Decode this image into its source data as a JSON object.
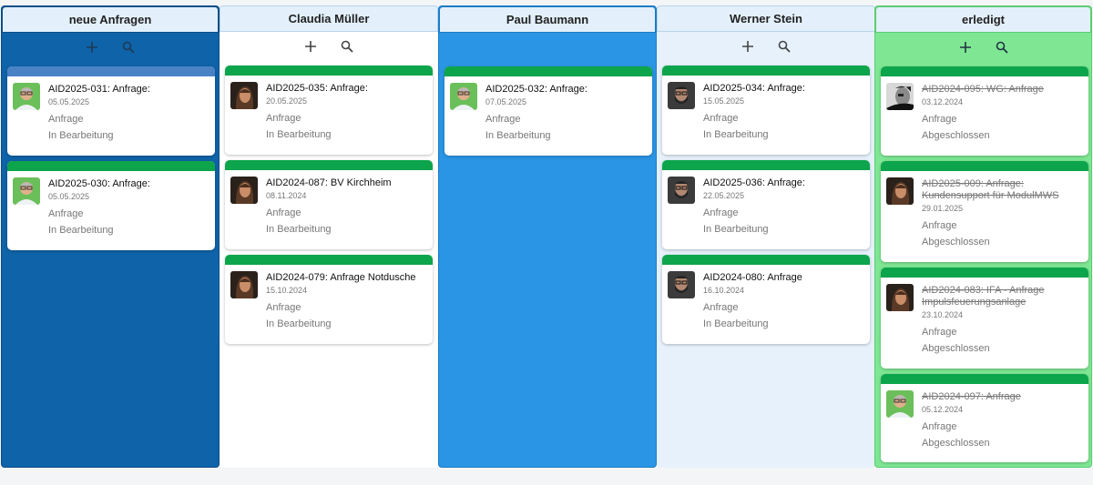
{
  "colors": {
    "col_neue": "#0f63a8",
    "col_claudia": "#ffffff",
    "col_paul": "#2a95e4",
    "col_werner": "#e6f1fb",
    "col_erledigt": "#7fe794",
    "card_bar_green": "#0ca54b",
    "card_bar_blue": "#4a82c6"
  },
  "columns": [
    {
      "title": "neue Anfragen",
      "icons": [
        "plus-icon",
        "search-icon"
      ],
      "cards": [
        {
          "id_title": "AID2025-031: Anfrage:",
          "date": "05.05.2025",
          "type": "Anfrage",
          "status": "In Bearbeitung",
          "avatar": "man-glasses-avatar"
        },
        {
          "id_title": "AID2025-030: Anfrage:",
          "date": "05.05.2025",
          "type": "Anfrage",
          "status": "In Bearbeitung",
          "avatar": "man-glasses-avatar"
        }
      ]
    },
    {
      "title": "Claudia Müller",
      "icons": [
        "plus-icon",
        "search-icon"
      ],
      "cards": [
        {
          "id_title": "AID2025-035: Anfrage:",
          "date": "20.05.2025",
          "type": "Anfrage",
          "status": "In Bearbeitung",
          "avatar": "woman-avatar"
        },
        {
          "id_title": "AID2024-087: BV Kirchheim",
          "date": "08.11.2024",
          "type": "Anfrage",
          "status": "In Bearbeitung",
          "avatar": "woman-avatar"
        },
        {
          "id_title": "AID2024-079: Anfrage Notdusche",
          "date": "15.10.2024",
          "type": "Anfrage",
          "status": "In Bearbeitung",
          "avatar": "woman-avatar"
        }
      ]
    },
    {
      "title": "Paul Baumann",
      "icons": [],
      "cards": [
        {
          "id_title": "AID2025-032: Anfrage:",
          "date": "07.05.2025",
          "type": "Anfrage",
          "status": "In Bearbeitung",
          "avatar": "man-glasses-avatar"
        }
      ]
    },
    {
      "title": "Werner Stein",
      "icons": [
        "plus-icon",
        "search-icon"
      ],
      "cards": [
        {
          "id_title": "AID2025-034: Anfrage:",
          "date": "15.05.2025",
          "type": "Anfrage",
          "status": "In Bearbeitung",
          "avatar": "man-beard-avatar"
        },
        {
          "id_title": "AID2025-036: Anfrage:",
          "date": "22.05.2025",
          "type": "Anfrage",
          "status": "In Bearbeitung",
          "avatar": "man-beard-avatar"
        },
        {
          "id_title": "AID2024-080: Anfrage",
          "date": "16.10.2024",
          "type": "Anfrage",
          "status": "In Bearbeitung",
          "avatar": "man-beard-avatar"
        }
      ]
    },
    {
      "title": "erledigt",
      "icons": [
        "plus-icon",
        "search-icon"
      ],
      "cards": [
        {
          "id_title": "AID2024-095: WG: Anfrage",
          "date": "03.12.2024",
          "type": "Anfrage",
          "status": "Abgeschlossen",
          "avatar": "man-bw-avatar"
        },
        {
          "id_title": "AID2025-009: Anfrage: Kundensupport für ModulMWS",
          "date": "29.01.2025",
          "type": "Anfrage",
          "status": "Abgeschlossen",
          "avatar": "woman-avatar"
        },
        {
          "id_title": "AID2024-083: IFA - Anfrage Impulsfeuerungsanlage",
          "date": "23.10.2024",
          "type": "Anfrage",
          "status": "Abgeschlossen",
          "avatar": "woman-avatar"
        },
        {
          "id_title": "AID2024-097: Anfrage",
          "date": "05.12.2024",
          "type": "Anfrage",
          "status": "Abgeschlossen",
          "avatar": "man-glasses-avatar"
        }
      ]
    }
  ]
}
